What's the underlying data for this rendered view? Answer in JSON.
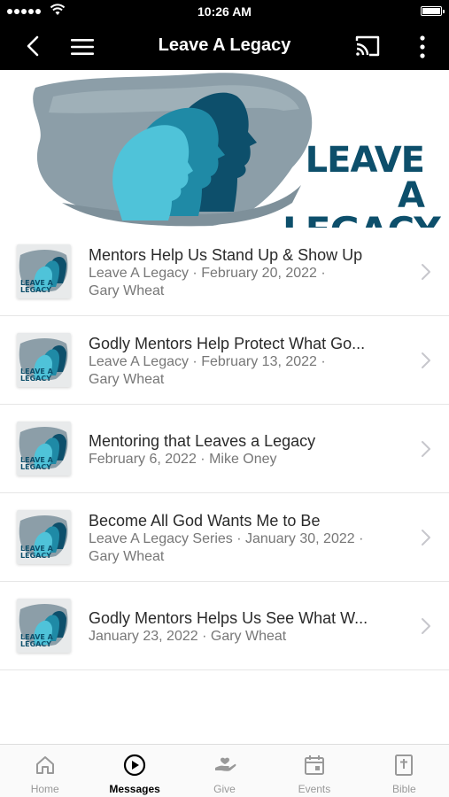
{
  "status_bar": {
    "time": "10:26 AM"
  },
  "nav": {
    "title": "Leave A Legacy"
  },
  "banner": {
    "title_line1": "LEAVE A",
    "title_line2": "LEGACY"
  },
  "thumb_text": {
    "line1": "LEAVE A",
    "line2": "LEGACY"
  },
  "items": [
    {
      "title": "Mentors Help Us Stand Up & Show Up",
      "meta1": "Leave A Legacy · February 20, 2022 ·",
      "meta2": "Gary Wheat"
    },
    {
      "title": "Godly Mentors Help Protect What Go...",
      "meta1": "Leave A Legacy · February 13, 2022 ·",
      "meta2": "Gary Wheat"
    },
    {
      "title": "Mentoring that Leaves a Legacy",
      "meta1": "February 6, 2022 · Mike Oney",
      "meta2": ""
    },
    {
      "title": "Become All God Wants Me to Be",
      "meta1": "Leave A Legacy Series · January 30, 2022 ·",
      "meta2": "Gary Wheat"
    },
    {
      "title": "Godly Mentors Helps Us See What W...",
      "meta1": "January 23, 2022 · Gary Wheat",
      "meta2": ""
    }
  ],
  "tabs": [
    {
      "label": "Home",
      "icon": "home-icon",
      "active": false
    },
    {
      "label": "Messages",
      "icon": "play-circle-icon",
      "active": true
    },
    {
      "label": "Give",
      "icon": "give-hand-icon",
      "active": false
    },
    {
      "label": "Events",
      "icon": "calendar-icon",
      "active": false
    },
    {
      "label": "Bible",
      "icon": "bible-icon",
      "active": false
    }
  ],
  "colors": {
    "header_bg": "#000000",
    "banner_dark_teal": "#0d4f6b",
    "banner_light_teal": "#4fc3d9",
    "banner_gray": "#8c9ea8",
    "active_tab": "#000000",
    "inactive_tab": "#999999"
  }
}
